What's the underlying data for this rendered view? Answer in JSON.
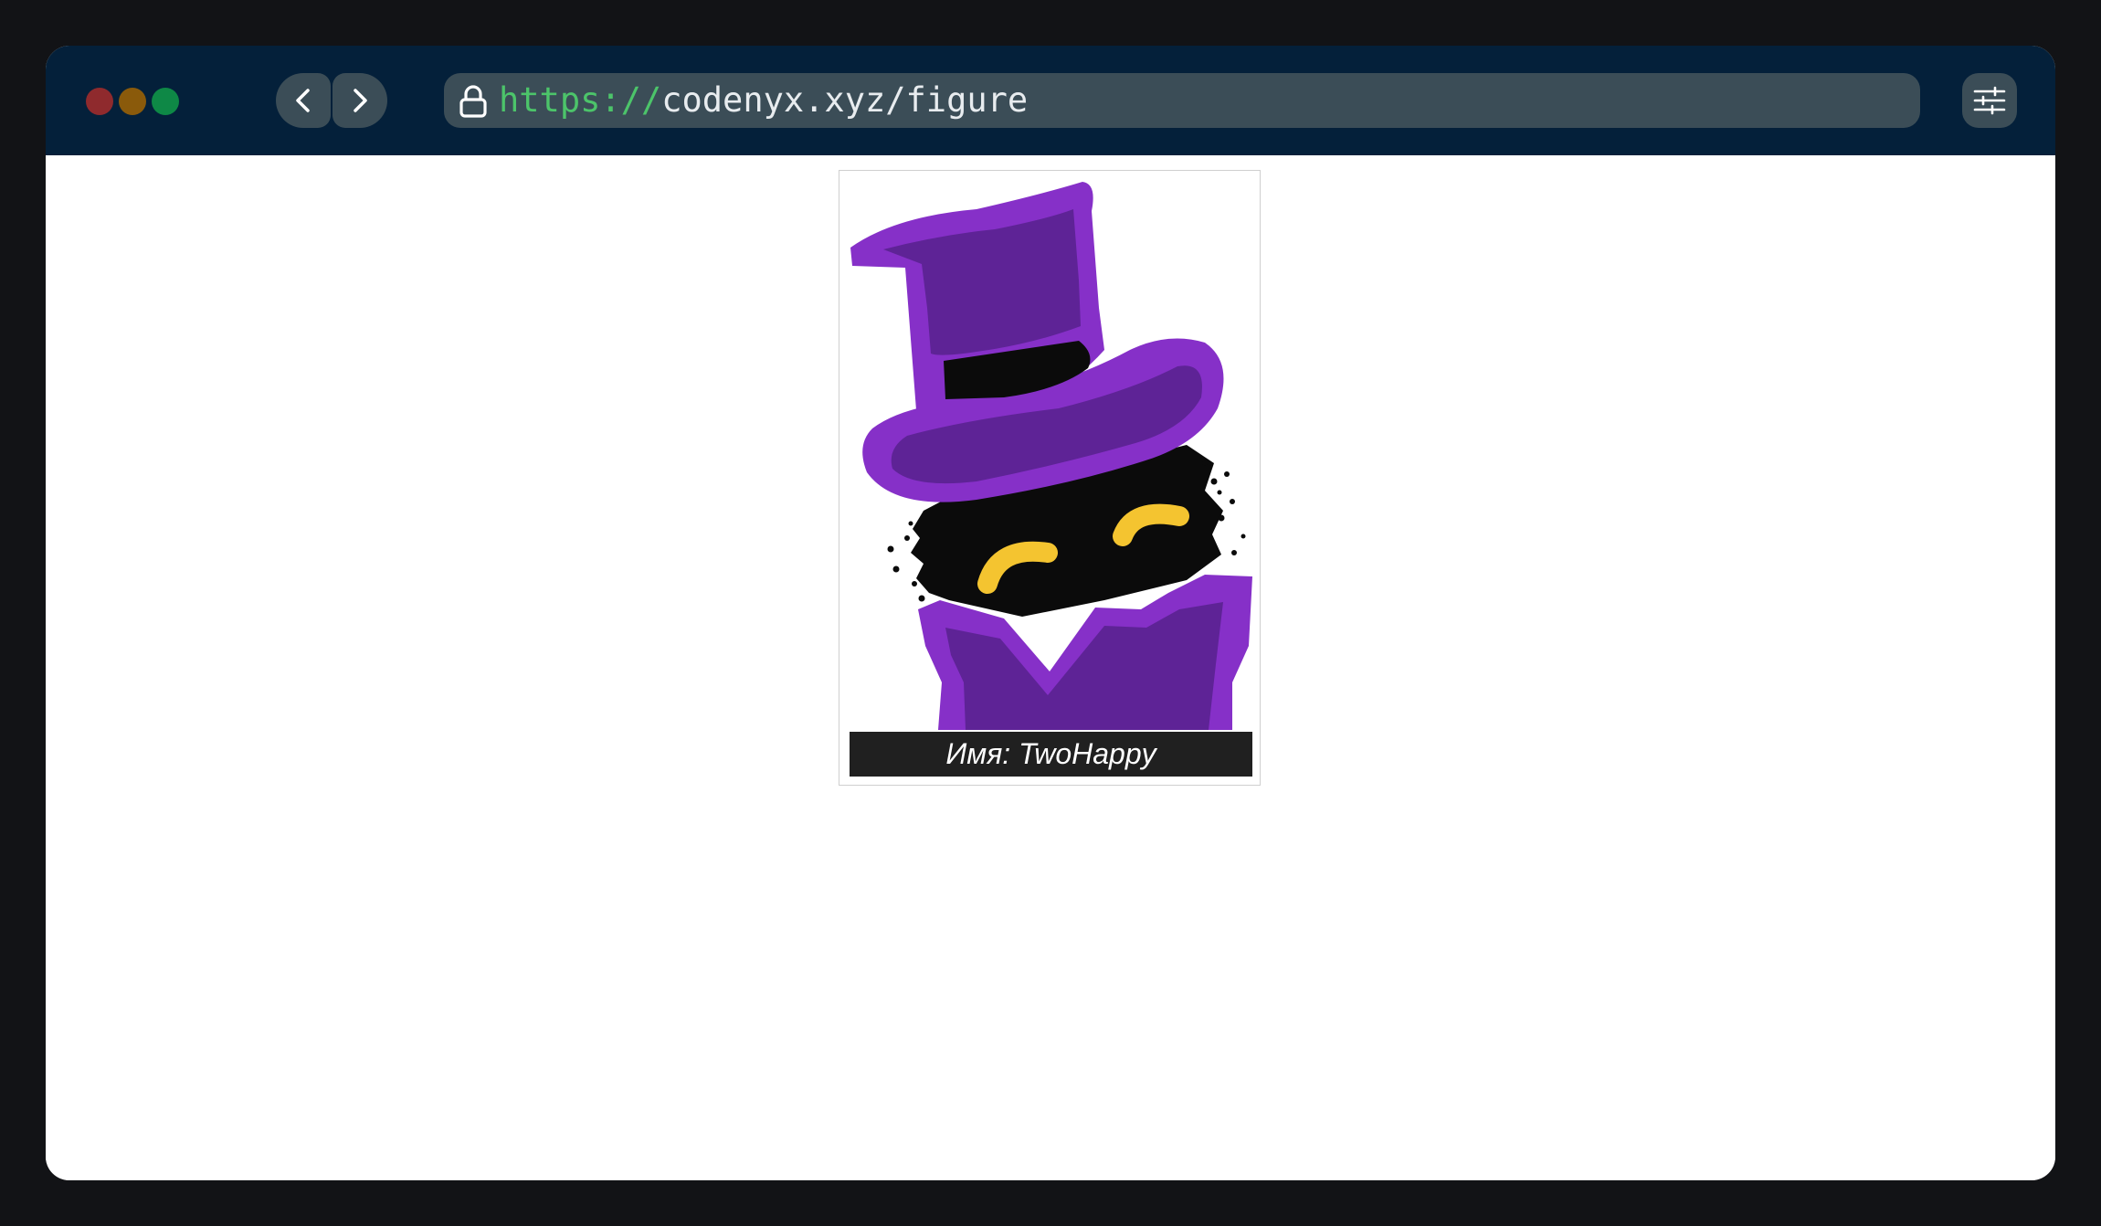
{
  "browser": {
    "url_scheme": "https://",
    "url_path": "codenyx.xyz/figure",
    "colors": {
      "titlebar": "#04203a",
      "control": "#3b4d57",
      "scheme": "#4cc46a"
    },
    "icons": {
      "back": "chevron-left-icon",
      "forward": "chevron-right-icon",
      "lock": "lock-icon",
      "settings": "sliders-icon"
    }
  },
  "figure": {
    "caption": "Имя: TwoHappy",
    "colors": {
      "hat": "#8630c8",
      "hat_shade": "#5e2396",
      "body": "#0b0b0b",
      "eyes": "#f4c430"
    }
  }
}
